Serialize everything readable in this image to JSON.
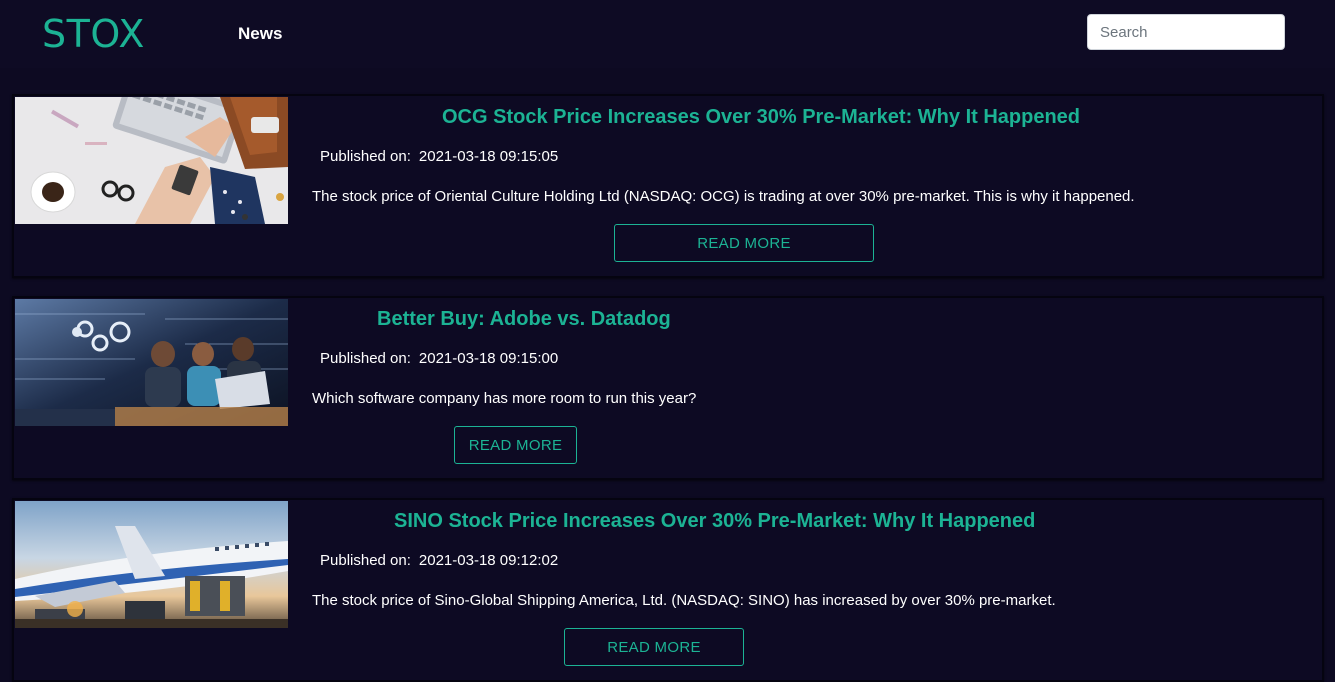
{
  "brand": {
    "logo": "STOX"
  },
  "nav": {
    "news_label": "News"
  },
  "search": {
    "placeholder": "Search"
  },
  "articles": [
    {
      "title": "OCG Stock Price Increases Over 30% Pre-Market: Why It Happened",
      "published_label": "Published on:",
      "published_date": "2021-03-18 09:15:05",
      "summary": "The stock price of Oriental Culture Holding Ltd (NASDAQ: OCG) is trading at over 30% pre-market. This is why it happened.",
      "read_more": "READ MORE",
      "image_icon": "laptop-desk-photo"
    },
    {
      "title": "Better Buy: Adobe vs. Datadog",
      "published_label": "Published on:",
      "published_date": "2021-03-18 09:15:00",
      "summary": "Which software company has more room to run this year?",
      "read_more": "READ MORE",
      "image_icon": "team-monitor-photo"
    },
    {
      "title": "SINO Stock Price Increases Over 30% Pre-Market: Why It Happened",
      "published_label": "Published on:",
      "published_date": "2021-03-18 09:12:02",
      "summary": "The stock price of Sino-Global Shipping America, Ltd. (NASDAQ: SINO) has increased by over 30% pre-market.",
      "read_more": "READ MORE",
      "image_icon": "cargo-airplane-photo"
    }
  ],
  "colors": {
    "background": "#0d0a22",
    "accent": "#1cb394",
    "text": "#ffffff"
  }
}
